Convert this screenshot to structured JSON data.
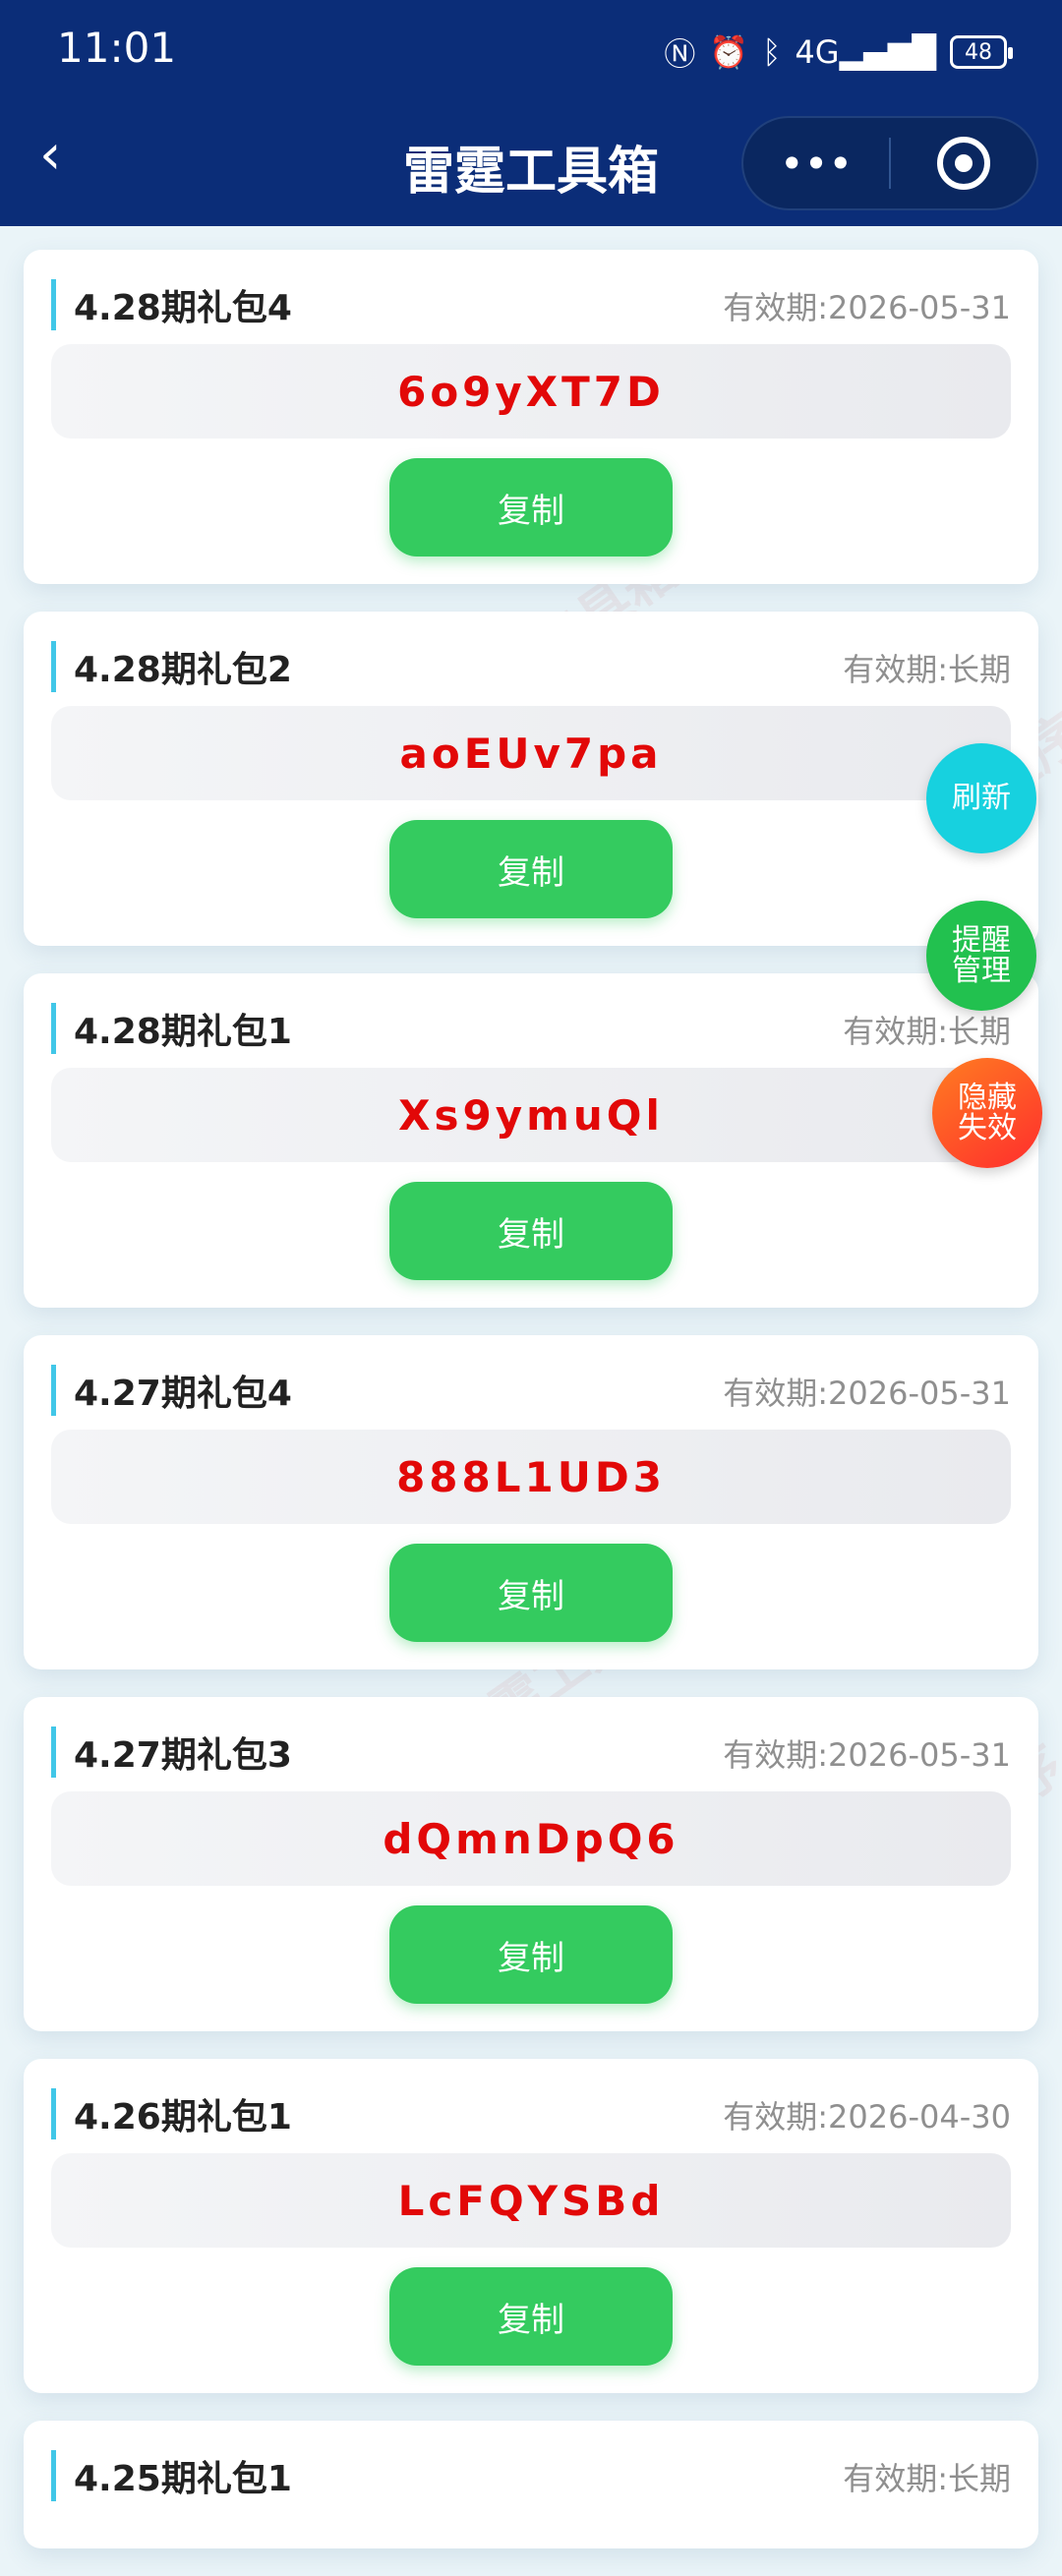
{
  "status": {
    "time": "11:01",
    "battery": "48"
  },
  "header": {
    "title": "雷霆工具箱"
  },
  "cards": [
    {
      "name": "4.28期礼包4",
      "validity": "有效期:2026-05-31",
      "code": "6o9yXT7D",
      "copy": "复制"
    },
    {
      "name": "4.28期礼包2",
      "validity": "有效期:长期",
      "code": "aoEUv7pa",
      "copy": "复制"
    },
    {
      "name": "4.28期礼包1",
      "validity": "有效期:长期",
      "code": "Xs9ymuQl",
      "copy": "复制"
    },
    {
      "name": "4.27期礼包4",
      "validity": "有效期:2026-05-31",
      "code": "888L1UD3",
      "copy": "复制"
    },
    {
      "name": "4.27期礼包3",
      "validity": "有效期:2026-05-31",
      "code": "dQmnDpQ6",
      "copy": "复制"
    },
    {
      "name": "4.26期礼包1",
      "validity": "有效期:2026-04-30",
      "code": "LcFQYSBd",
      "copy": "复制"
    },
    {
      "name": "4.25期礼包1",
      "validity": "有效期:长期"
    }
  ],
  "floating": {
    "refresh": "刷新",
    "remind": "提醒\n管理",
    "hide": "隐藏\n失效"
  },
  "watermark": "微信小程序 雷霆工具箱"
}
